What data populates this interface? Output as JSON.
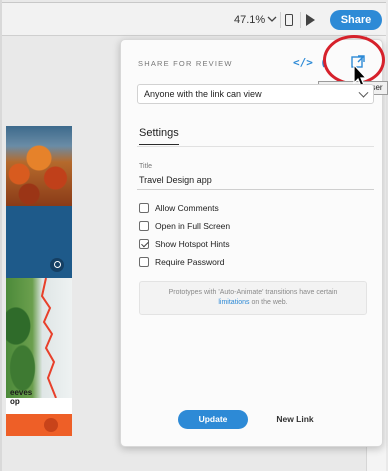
{
  "toolbar": {
    "zoom": "47.1%",
    "share_label": "Share"
  },
  "artboard": {
    "title": "eeves\nop"
  },
  "share_popover": {
    "title": "SHARE FOR REVIEW",
    "icons": [
      "embed-code-icon",
      "link-icon",
      "open-in-browser-icon"
    ],
    "tooltip": "Open in Browser",
    "access": "Anyone with the link can view",
    "settings_tab": "Settings",
    "title_label": "Title",
    "title_value": "Travel Design app",
    "options": [
      {
        "label": "Allow Comments",
        "checked": false
      },
      {
        "label": "Open in Full Screen",
        "checked": false
      },
      {
        "label": "Show Hotspot Hints",
        "checked": true
      },
      {
        "label": "Require Password",
        "checked": false
      }
    ],
    "notice_text": "Prototypes with 'Auto-Animate' transitions have certain",
    "notice_link": "limitations",
    "notice_suffix": "on the web.",
    "update_label": "Update",
    "new_link_label": "New Link"
  },
  "colors": {
    "accent": "#2d8ad6",
    "highlight_ring": "#d6212b",
    "artboard_blue": "#1e5a8a",
    "artboard_orange": "#ee5f27"
  }
}
